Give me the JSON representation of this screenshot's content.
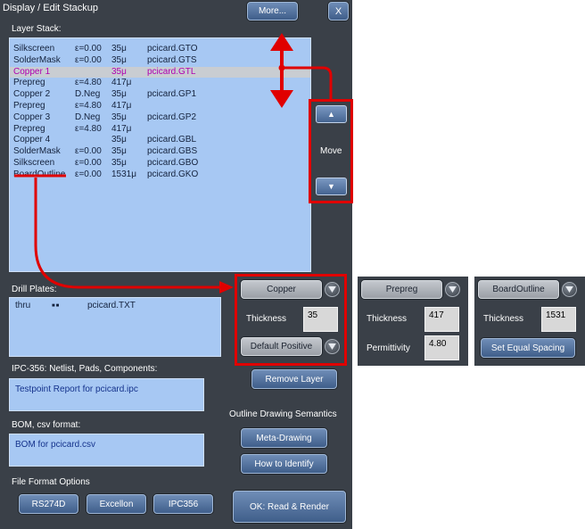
{
  "window": {
    "title": "Display / Edit Stackup",
    "more_label": "More...",
    "close_label": "X"
  },
  "layer_stack": {
    "label": "Layer Stack:",
    "rows": [
      {
        "name": "Silkscreen",
        "param": "ε=0.00",
        "thick": "35μ",
        "file": "pcicard.GTO",
        "selected": false
      },
      {
        "name": "SolderMask",
        "param": "ε=0.00",
        "thick": "35μ",
        "file": "pcicard.GTS",
        "selected": false
      },
      {
        "name": "Copper  1",
        "param": "",
        "thick": "35μ",
        "file": "pcicard.GTL",
        "selected": true
      },
      {
        "name": "Prepreg",
        "param": "ε=4.80",
        "thick": "417μ",
        "file": "",
        "selected": false
      },
      {
        "name": "Copper  2",
        "param": "D.Neg",
        "thick": "35μ",
        "file": "pcicard.GP1",
        "selected": false
      },
      {
        "name": "Prepreg",
        "param": "ε=4.80",
        "thick": "417μ",
        "file": "",
        "selected": false
      },
      {
        "name": "Copper  3",
        "param": "D.Neg",
        "thick": "35μ",
        "file": "pcicard.GP2",
        "selected": false
      },
      {
        "name": "Prepreg",
        "param": "ε=4.80",
        "thick": "417μ",
        "file": "",
        "selected": false
      },
      {
        "name": "Copper  4",
        "param": "",
        "thick": "35μ",
        "file": "pcicard.GBL",
        "selected": false
      },
      {
        "name": "SolderMask",
        "param": "ε=0.00",
        "thick": "35μ",
        "file": "pcicard.GBS",
        "selected": false
      },
      {
        "name": "Silkscreen",
        "param": "ε=0.00",
        "thick": "35μ",
        "file": "pcicard.GBO",
        "selected": false
      },
      {
        "name": "BoardOutline",
        "param": "ε=0.00",
        "thick": "1531μ",
        "file": "pcicard.GKO",
        "selected": false
      }
    ]
  },
  "move": {
    "label": "Move",
    "up_glyph": "▲",
    "down_glyph": "▼"
  },
  "drill": {
    "label": "Drill Plates:",
    "rows": [
      {
        "type": "thru",
        "marker": "■■",
        "file": "pcicard.TXT"
      }
    ]
  },
  "ipc": {
    "label": "IPC-356: Netlist, Pads, Components:",
    "value": "Testpoint Report for pcicard.ipc"
  },
  "bom": {
    "label": "BOM, csv format:",
    "value": "BOM for pcicard.csv"
  },
  "file_format": {
    "label": "File Format Options",
    "buttons": [
      "RS274D",
      "Excellon",
      "IPC356"
    ]
  },
  "copper_panel": {
    "type": "Copper",
    "thickness_label": "Thickness",
    "thickness": "35",
    "polarity": "Default Positive"
  },
  "prepreg_panel": {
    "type": "Prepreg",
    "thickness_label": "Thickness",
    "thickness": "417",
    "permittivity_label": "Permittivity",
    "permittivity": "4.80"
  },
  "outline_panel": {
    "type": "BoardOutline",
    "thickness_label": "Thickness",
    "thickness": "1531",
    "spacing_button": "Set Equal Spacing"
  },
  "remove_layer": "Remove Layer",
  "outline_semantics": {
    "label": "Outline Drawing Semantics",
    "meta_button": "Meta-Drawing",
    "identify_button": "How to Identify"
  },
  "ok_button": "OK:  Read & Render",
  "colors": {
    "annotation_red": "#e00000",
    "panel_bg": "#3a4048",
    "list_bg": "#a7c8f3",
    "selected_text": "#b000b0"
  }
}
